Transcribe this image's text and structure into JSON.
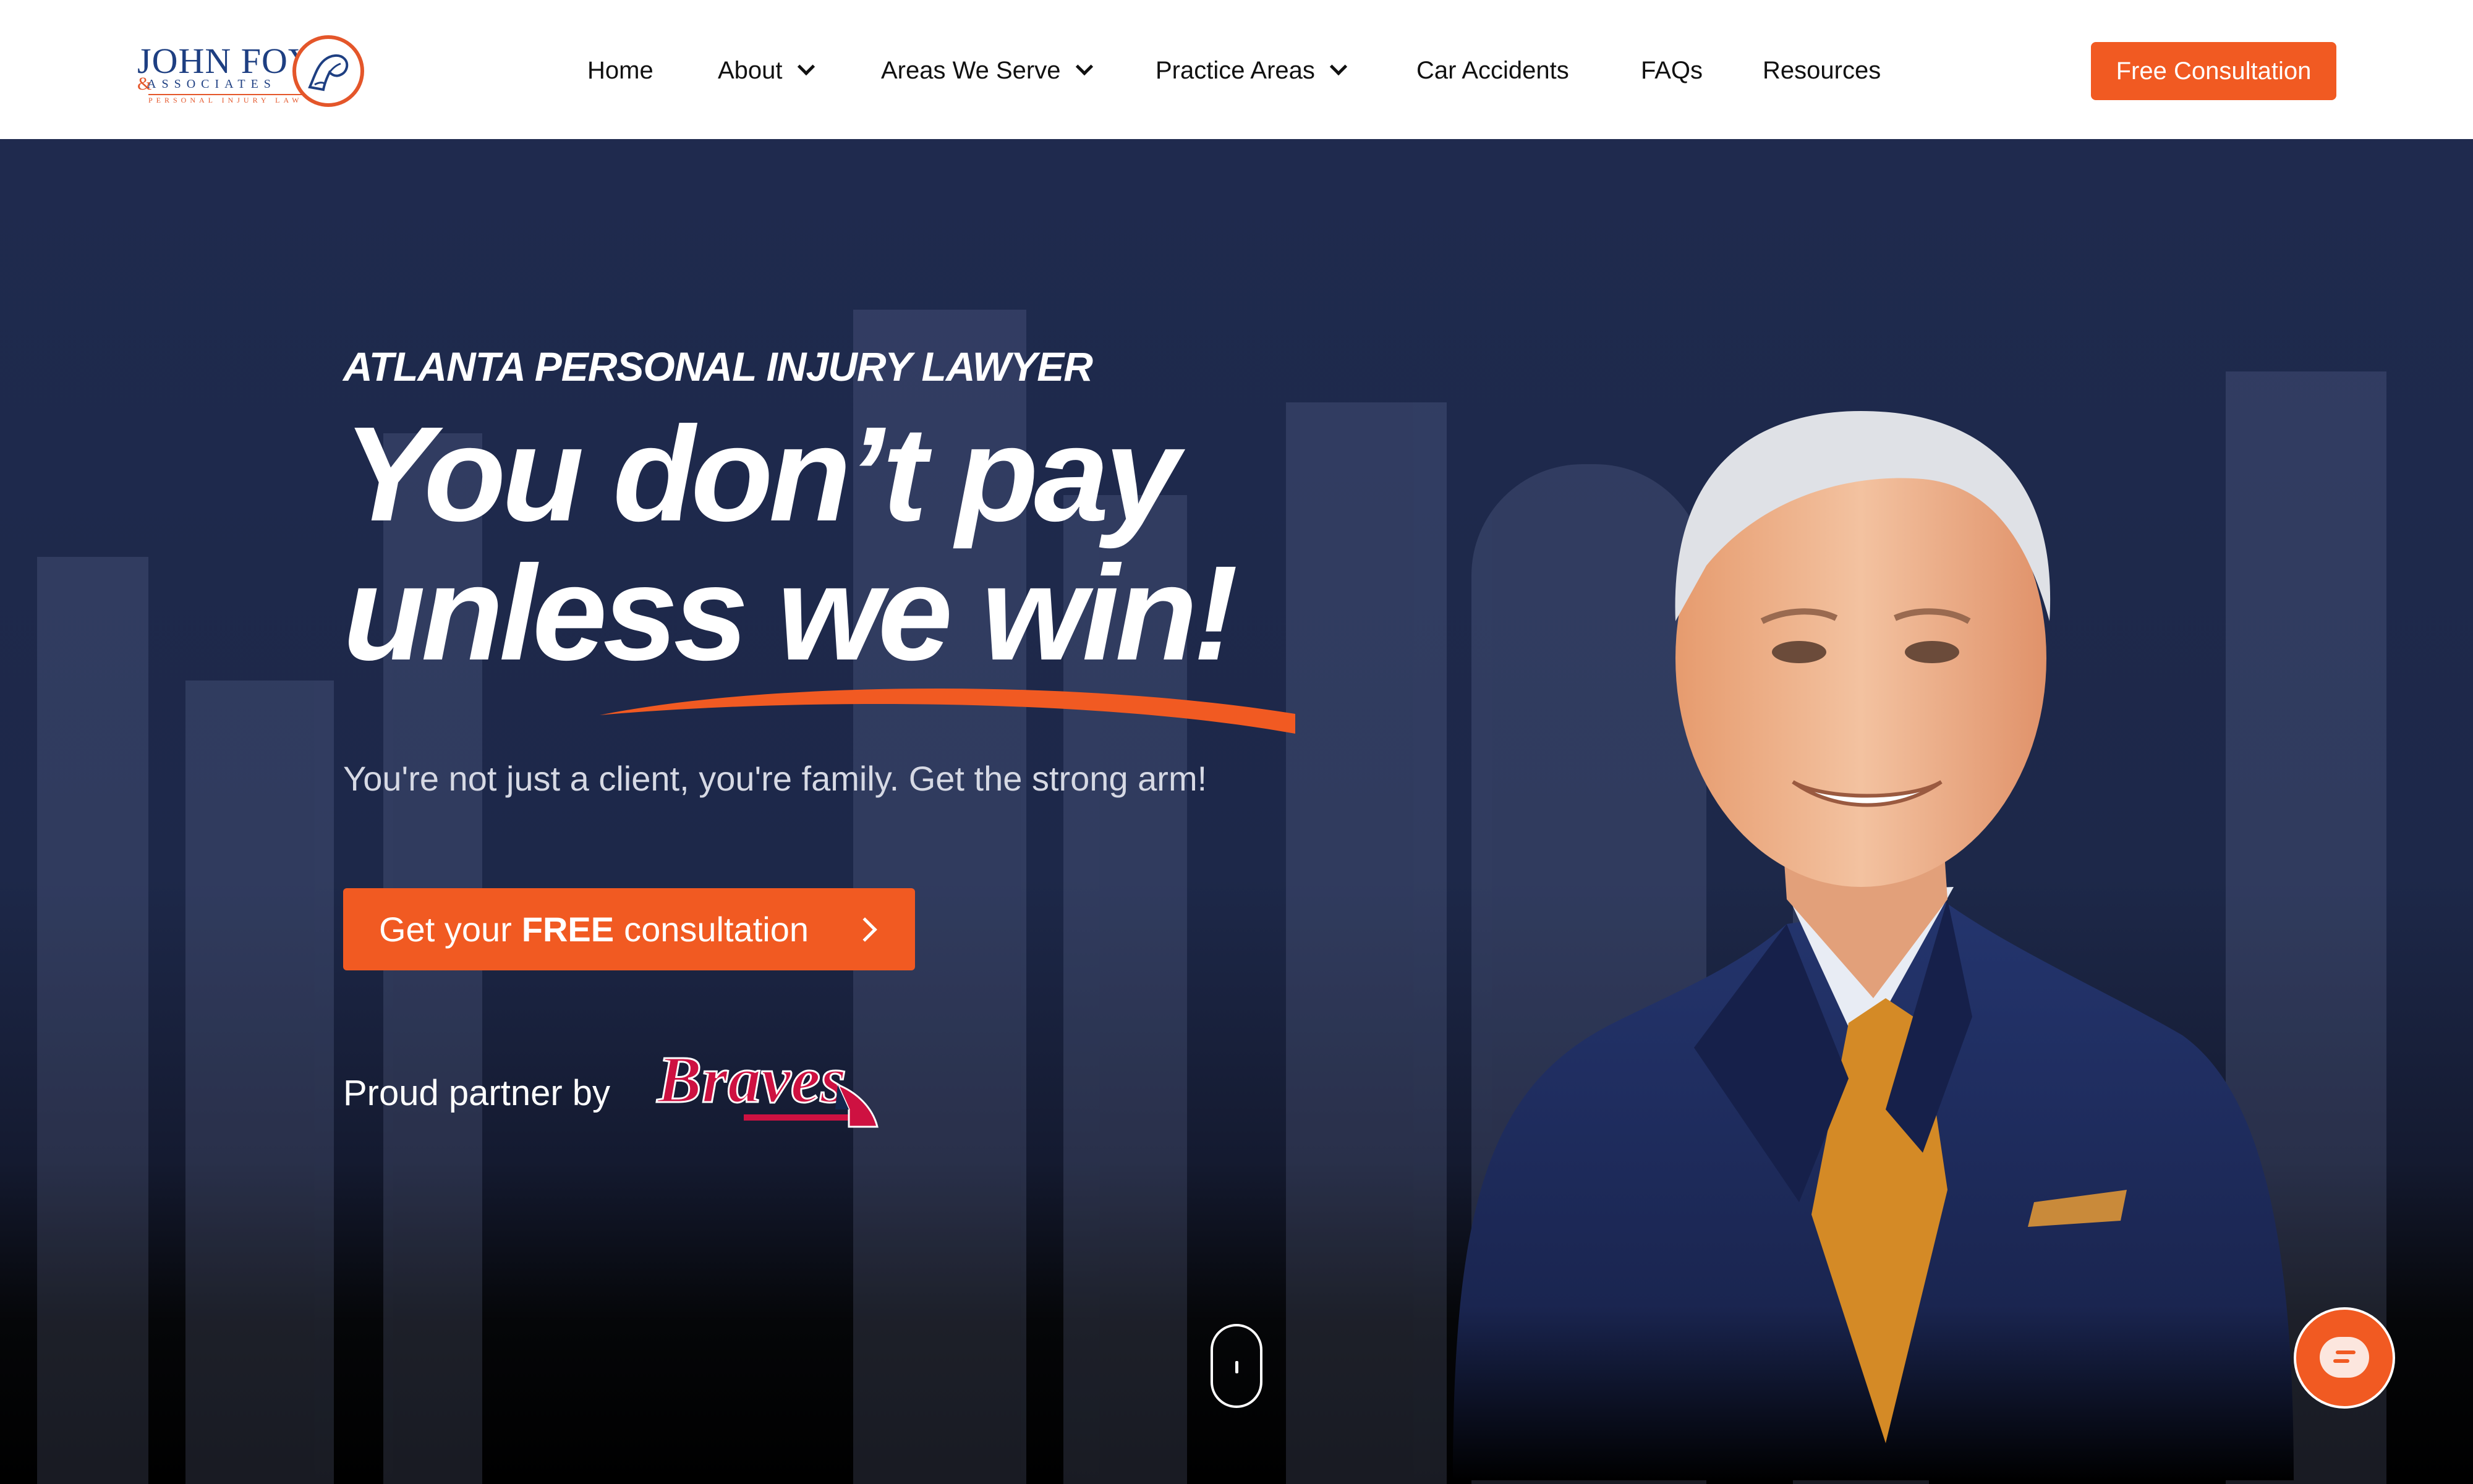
{
  "header": {
    "logo": {
      "name": "JOHN FOY",
      "amp": "&",
      "associates": "ASSOCIATES",
      "tagline": "PERSONAL INJURY LAW"
    },
    "nav": [
      {
        "label": "Home",
        "has_dropdown": false
      },
      {
        "label": "About",
        "has_dropdown": true
      },
      {
        "label": "Areas We Serve",
        "has_dropdown": true
      },
      {
        "label": "Practice Areas",
        "has_dropdown": true
      },
      {
        "label": "Car Accidents",
        "has_dropdown": false
      },
      {
        "label": "FAQs",
        "has_dropdown": false
      },
      {
        "label": "Resources",
        "has_dropdown": false
      }
    ],
    "cta_label": "Free Consultation"
  },
  "hero": {
    "kicker": "ATLANTA PERSONAL INJURY LAWYER",
    "headline_line1": "You don’t pay",
    "headline_line2": "unless we win!",
    "subhead": "You're not just a client, you're family. Get the strong arm!",
    "cta": {
      "pre": "Get your",
      "bold": "FREE",
      "post": "consultation"
    },
    "partner_label": "Proud partner by",
    "partner_logo_text": "Braves"
  },
  "colors": {
    "accent": "#f15a22",
    "navy": "#1f2a4e",
    "logo_blue": "#1e3f82"
  },
  "icons": [
    "chevron-down-icon",
    "chevron-right-icon",
    "scroll-mouse-icon",
    "chat-icon"
  ]
}
